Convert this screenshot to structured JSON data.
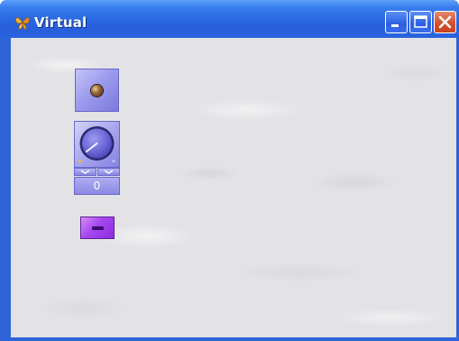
{
  "window": {
    "title": "Virtual",
    "icon": "app-butterfly-icon",
    "controls": {
      "minimize_icon": "minimize-icon",
      "maximize_icon": "maximize-icon",
      "close_icon": "close-icon"
    }
  },
  "controls": {
    "led_button_icon": "led-indicator-icon",
    "knob_icon": "rotary-knob-icon",
    "spinner": {
      "decrement_icon": "chevron-down-icon",
      "increment_icon": "chevron-up-icon"
    },
    "knob_value": "0",
    "toggle_icon": "toggle-bar-icon"
  },
  "colors": {
    "title_bar": "#2d6ee6",
    "client_background": "#e3e3e6",
    "control_purple": "#9e9cee",
    "toggle_purple": "#a646ee"
  }
}
